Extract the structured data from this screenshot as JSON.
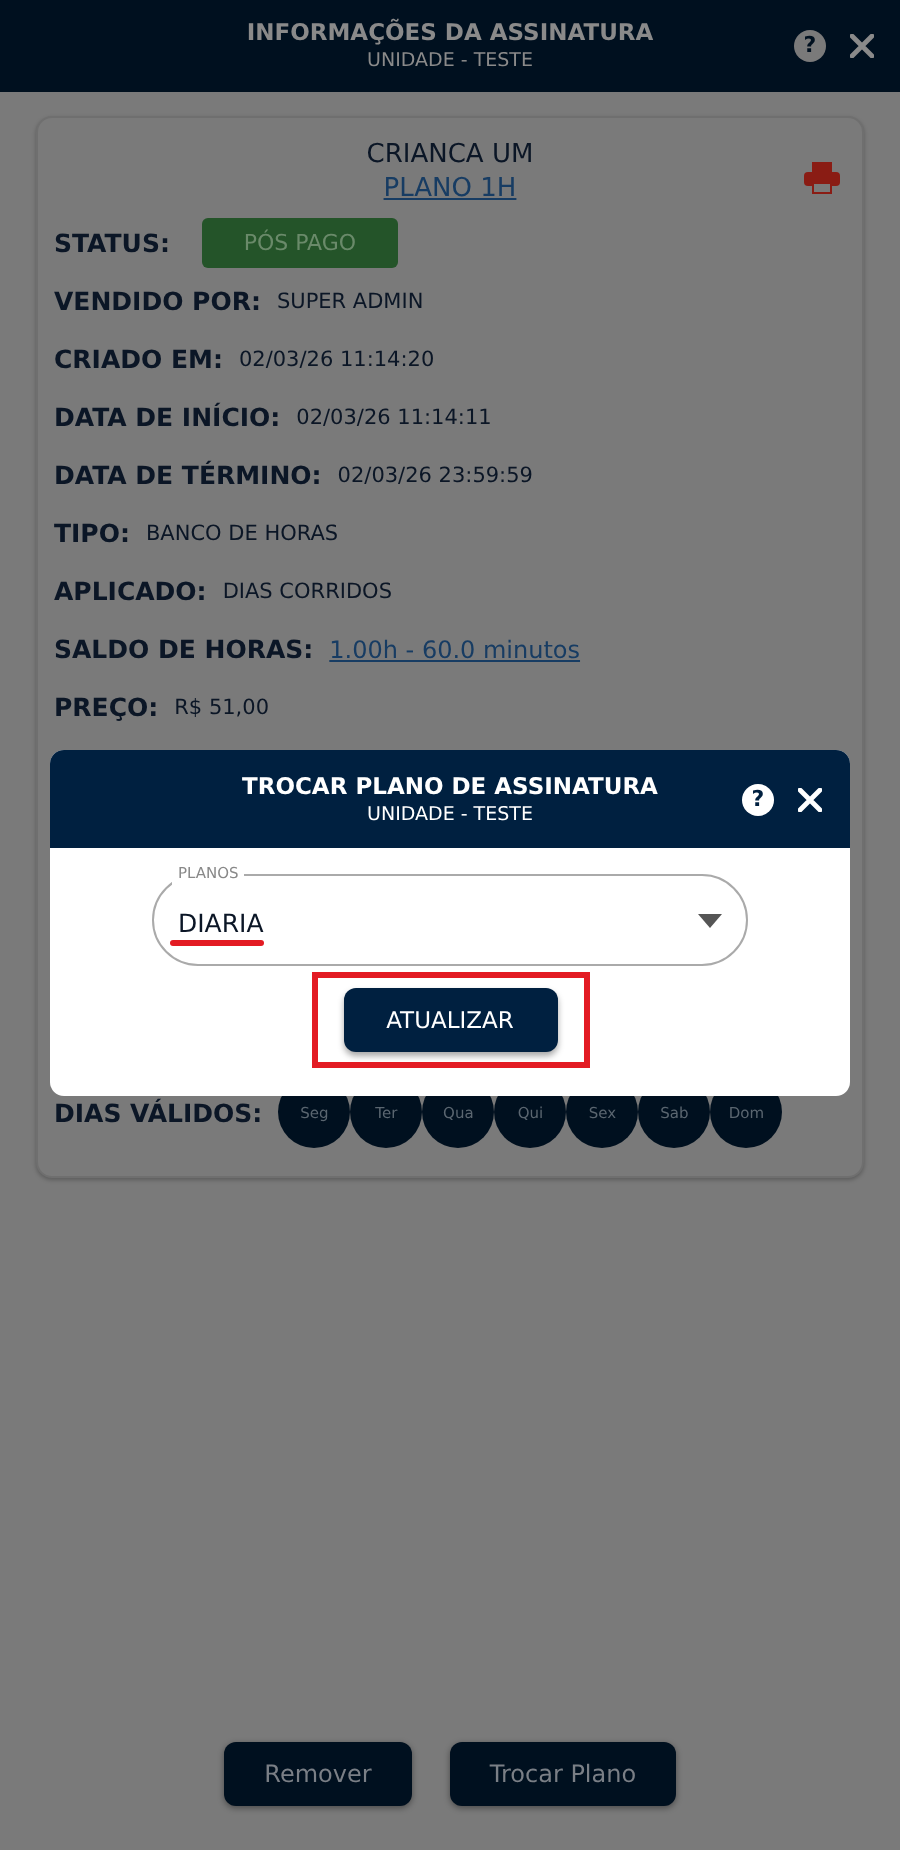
{
  "window": {
    "title": "INFORMAÇÕES DA ASSINATURA",
    "subtitle": "UNIDADE - TESTE",
    "help": "?"
  },
  "card": {
    "name": "CRIANCA UM",
    "plan_link": "PLANO 1H",
    "fields": [
      {
        "kind": "badge",
        "label": "STATUS:",
        "value": "PÓS PAGO"
      },
      {
        "kind": "text",
        "label": "VENDIDO POR:",
        "value": "SUPER ADMIN"
      },
      {
        "kind": "text",
        "label": "CRIADO EM:",
        "value": "02/03/26 11:14:20"
      },
      {
        "kind": "text",
        "label": "DATA DE INÍCIO:",
        "value": "02/03/26 11:14:11"
      },
      {
        "kind": "text",
        "label": "DATA DE TÉRMINO:",
        "value": "02/03/26 23:59:59"
      },
      {
        "kind": "text",
        "label": "TIPO:",
        "value": "BANCO DE HORAS"
      },
      {
        "kind": "text",
        "label": "APLICADO:",
        "value": "DIAS CORRIDOS"
      },
      {
        "kind": "link",
        "label": "SALDO DE HORAS:",
        "value": "1.00h - 60.0 minutos"
      },
      {
        "kind": "text",
        "label": "PREÇO:",
        "value": "R$ 51,00"
      }
    ],
    "valid_days": {
      "label": "DIAS VÁLIDOS:",
      "days": [
        "Seg",
        "Ter",
        "Qua",
        "Qui",
        "Sex",
        "Sab",
        "Dom"
      ]
    }
  },
  "dialog": {
    "title": "TROCAR PLANO DE ASSINATURA",
    "subtitle": "UNIDADE - TESTE",
    "help": "?",
    "select": {
      "label": "PLANOS",
      "value": "DIARIA",
      "marked": true
    },
    "button": {
      "label": "ATUALIZAR",
      "highlighted": true
    }
  },
  "footer_buttons": [
    "Remover",
    "Trocar Plano"
  ]
}
